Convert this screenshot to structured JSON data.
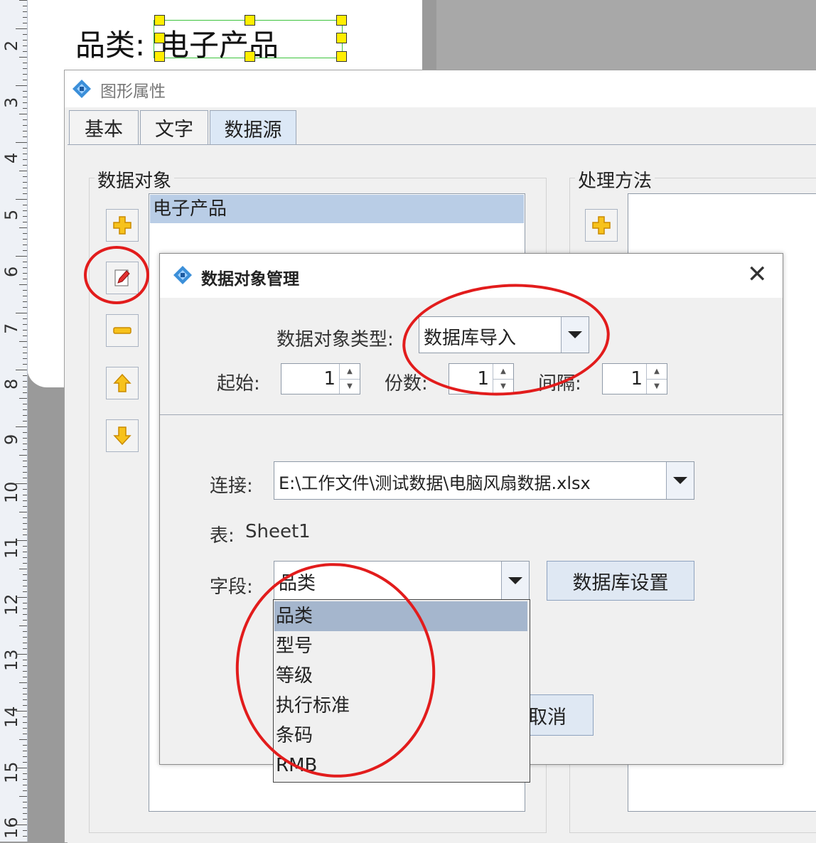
{
  "label_preview": {
    "static_text": "品类:",
    "bound_text": "电子产品"
  },
  "ruler": {
    "numbers": [
      "2",
      "3",
      "4",
      "5",
      "6",
      "7",
      "8",
      "9",
      "10",
      "11",
      "12",
      "13",
      "14",
      "15",
      "16"
    ]
  },
  "properties_dialog": {
    "title": "图形属性",
    "tabs": [
      {
        "label": "基本"
      },
      {
        "label": "文字"
      },
      {
        "label": "数据源"
      }
    ],
    "data_object_group": {
      "title": "数据对象",
      "items": [
        "电子产品"
      ]
    },
    "processing_group": {
      "title": "处理方法"
    }
  },
  "data_object_dialog": {
    "title": "数据对象管理",
    "close_symbol": "✕",
    "type_label": "数据对象类型:",
    "type_value": "数据库导入",
    "start_label": "起始:",
    "start_value": "1",
    "copies_label": "份数:",
    "copies_value": "1",
    "interval_label": "间隔:",
    "interval_value": "1",
    "connection_label": "连接:",
    "connection_value": "E:\\工作文件\\测试数据\\电脑风扇数据.xlsx",
    "table_label": "表:",
    "table_value": "Sheet1",
    "field_label": "字段:",
    "field_value": "品类",
    "db_settings_button": "数据库设置",
    "cancel_button": "取消",
    "field_options": [
      "品类",
      "型号",
      "等级",
      "执行标准",
      "条码",
      "RMB"
    ]
  },
  "colors": {
    "highlight_red": "#e21c1c",
    "selection_blue": "#b9cde6",
    "handle_yellow": "#ffee00"
  }
}
